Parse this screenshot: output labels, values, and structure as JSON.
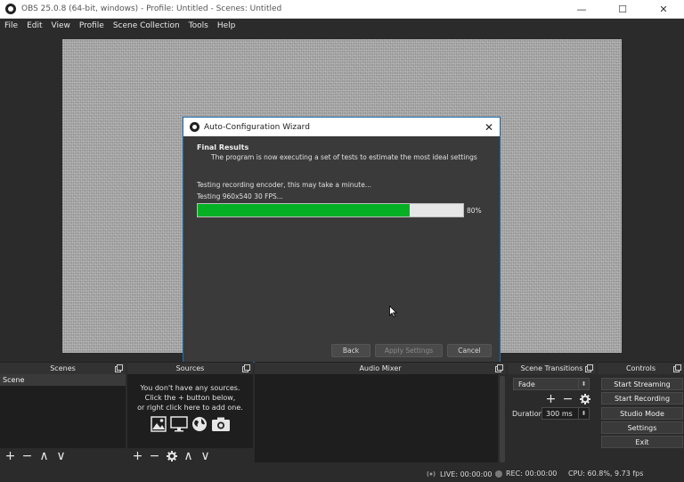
{
  "window": {
    "title": "OBS 25.0.8 (64-bit, windows) - Profile: Untitled - Scenes: Untitled",
    "controls": {
      "minimize": "—",
      "maximize": "☐",
      "close": "✕"
    }
  },
  "menu": [
    "File",
    "Edit",
    "View",
    "Profile",
    "Scene Collection",
    "Tools",
    "Help"
  ],
  "dialog": {
    "title": "Auto-Configuration Wizard",
    "close": "✕",
    "section_title": "Final Results",
    "section_desc": "The program is now executing a set of tests to estimate the most ideal settings",
    "status_line1": "Testing recording encoder, this may take a minute...",
    "status_line2": "Testing 960x540 30 FPS...",
    "progress_percent": 80,
    "progress_label": "80%",
    "buttons": {
      "back": "Back",
      "apply": "Apply Settings",
      "cancel": "Cancel"
    }
  },
  "docks": {
    "scenes": {
      "title": "Scenes",
      "items": [
        "Scene"
      ]
    },
    "sources": {
      "title": "Sources",
      "empty_lines": [
        "You don't have any sources.",
        "Click the + button below,",
        "or right click here to add one."
      ]
    },
    "mixer": {
      "title": "Audio Mixer"
    },
    "transitions": {
      "title": "Scene Transitions",
      "selected": "Fade",
      "duration_label": "Duration",
      "duration_value": "300 ms"
    },
    "controls": {
      "title": "Controls",
      "buttons": [
        "Start Streaming",
        "Start Recording",
        "Studio Mode",
        "Settings",
        "Exit"
      ]
    }
  },
  "toolbar_glyphs": {
    "add": "+",
    "remove": "−",
    "up": "∧",
    "down": "∨"
  },
  "status": {
    "live": "LIVE: 00:00:00",
    "rec": "REC: 00:00:00",
    "cpu": "CPU: 60.8%, 9.73 fps"
  },
  "colors": {
    "progress": "#06b025",
    "dialog_border": "#1f6fb2"
  }
}
